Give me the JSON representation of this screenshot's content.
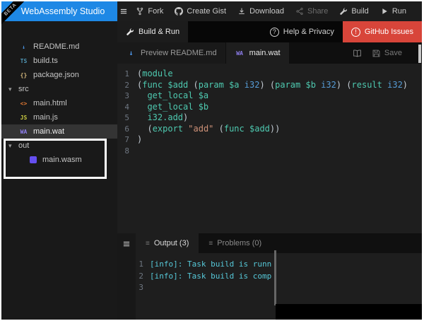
{
  "app": {
    "title": "WebAssembly Studio",
    "beta": "BETA"
  },
  "icons": {
    "question": "?",
    "alert": "!",
    "caret_down": "▾"
  },
  "toolbar": {
    "items": [
      {
        "label": "Fork",
        "icon": "fork-icon",
        "enabled": true
      },
      {
        "label": "Create Gist",
        "icon": "github-icon",
        "enabled": true
      },
      {
        "label": "Download",
        "icon": "download-icon",
        "enabled": true
      },
      {
        "label": "Share",
        "icon": "share-icon",
        "enabled": false
      },
      {
        "label": "Build",
        "icon": "wrench-icon",
        "enabled": true
      },
      {
        "label": "Run",
        "icon": "play-icon",
        "enabled": true
      }
    ]
  },
  "secondary_bar": {
    "build_run_label": "Build & Run",
    "help_label": "Help & Privacy",
    "issues_label": "GitHub Issues"
  },
  "file_tree": {
    "items": [
      {
        "label": "README.md",
        "icon": "markdown-icon",
        "depth": 1,
        "type": "file"
      },
      {
        "label": "build.ts",
        "icon": "ts-icon",
        "depth": 1,
        "type": "file"
      },
      {
        "label": "package.json",
        "icon": "json-icon",
        "depth": 1,
        "type": "file"
      },
      {
        "label": "src",
        "icon": "folder-icon",
        "depth": 0,
        "type": "folder",
        "expanded": true
      },
      {
        "label": "main.html",
        "icon": "html-icon",
        "depth": 1,
        "type": "file"
      },
      {
        "label": "main.js",
        "icon": "js-icon",
        "depth": 1,
        "type": "file"
      },
      {
        "label": "main.wat",
        "icon": "wa-icon",
        "depth": 1,
        "type": "file",
        "selected": true
      },
      {
        "label": "out",
        "icon": "folder-icon",
        "depth": 0,
        "type": "folder",
        "expanded": true,
        "highlighted": true
      },
      {
        "label": "main.wasm",
        "icon": "wasm-icon",
        "depth": 2,
        "type": "file",
        "highlighted": true
      }
    ]
  },
  "editor": {
    "tabs": [
      {
        "label": "Preview README.md",
        "icon": "preview-icon",
        "active": false
      },
      {
        "label": "main.wat",
        "icon": "wa-icon",
        "active": true
      }
    ],
    "save_label": "Save",
    "language": "wat",
    "lines": [
      {
        "num": 1,
        "tokens": [
          [
            "p",
            "("
          ],
          [
            "k",
            "module"
          ]
        ]
      },
      {
        "num": 2,
        "tokens": [
          [
            "p",
            "("
          ],
          [
            "k",
            "func"
          ],
          [
            "v",
            " $add"
          ],
          [
            "p",
            " ("
          ],
          [
            "k",
            "param"
          ],
          [
            "v",
            " $a"
          ],
          [
            "t",
            " i32"
          ],
          [
            "p",
            ") ("
          ],
          [
            "k",
            "param"
          ],
          [
            "v",
            " $b"
          ],
          [
            "t",
            " i32"
          ],
          [
            "p",
            ") ("
          ],
          [
            "k",
            "result"
          ],
          [
            "t",
            " i32"
          ],
          [
            "p",
            ")"
          ]
        ]
      },
      {
        "num": 3,
        "tokens": [
          [
            "k",
            "  get_local"
          ],
          [
            "v",
            " $a"
          ]
        ]
      },
      {
        "num": 4,
        "tokens": [
          [
            "k",
            "  get_local"
          ],
          [
            "v",
            " $b"
          ]
        ]
      },
      {
        "num": 5,
        "tokens": [
          [
            "k",
            "  i32.add"
          ],
          [
            "p",
            ")"
          ]
        ]
      },
      {
        "num": 6,
        "tokens": [
          [
            "p",
            "  ("
          ],
          [
            "k",
            "export"
          ],
          [
            "s",
            " \"add\""
          ],
          [
            "p",
            " ("
          ],
          [
            "k",
            "func"
          ],
          [
            "v",
            " $add"
          ],
          [
            "p",
            "))"
          ]
        ]
      },
      {
        "num": 7,
        "tokens": [
          [
            "p",
            ")"
          ]
        ]
      },
      {
        "num": 8,
        "tokens": []
      }
    ]
  },
  "console": {
    "tabs": [
      {
        "label": "Output (3)",
        "active": true
      },
      {
        "label": "Problems (0)",
        "active": false
      }
    ],
    "lines": [
      {
        "num": 1,
        "text": "[info]: Task build is runn"
      },
      {
        "num": 2,
        "text": "[info]: Task build is comp"
      },
      {
        "num": 3,
        "text": ""
      }
    ]
  },
  "colors": {
    "header_blue": "#1e88e5",
    "issues_red": "#d8453a",
    "wa_purple": "#654ff0",
    "keyword_teal": "#4ec9b0",
    "type_blue": "#569cd6",
    "string_orange": "#ce9178",
    "console_cyan": "#56c8d8"
  }
}
